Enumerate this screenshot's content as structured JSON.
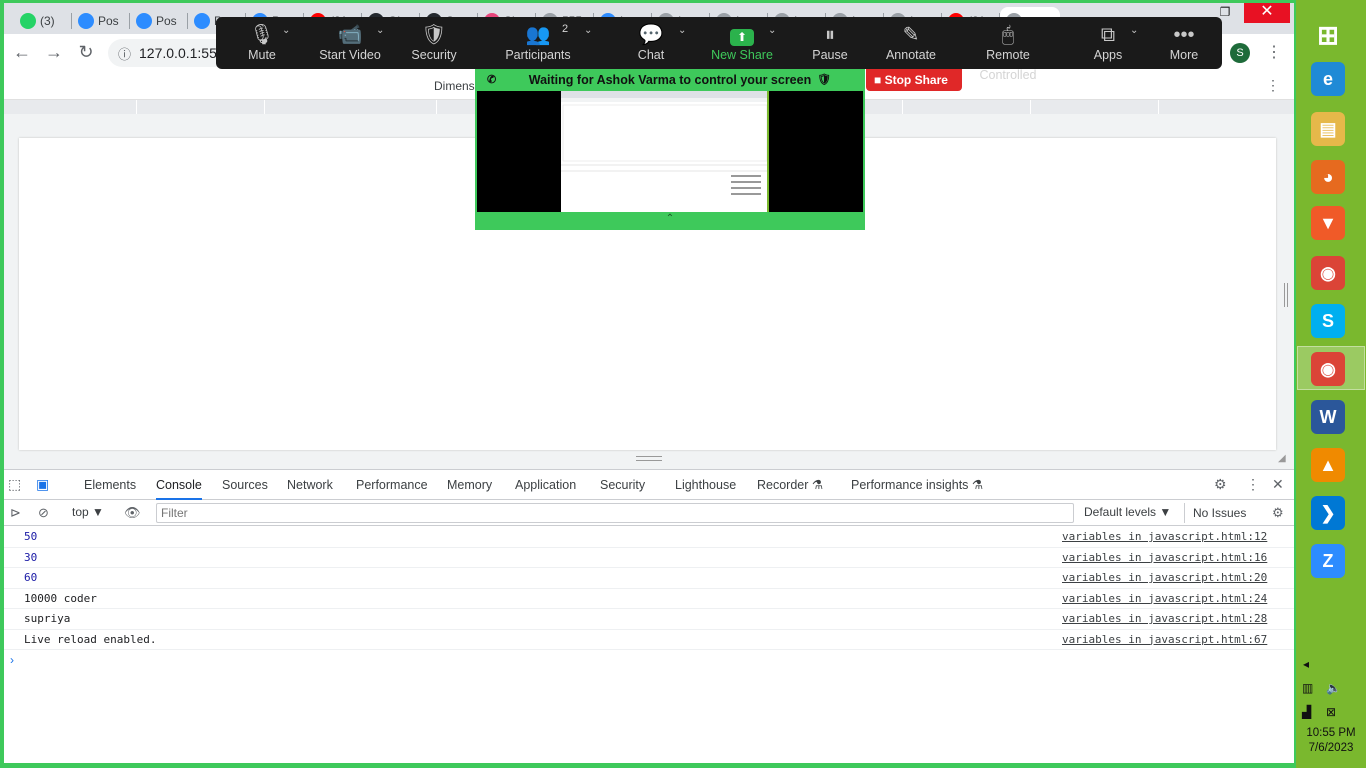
{
  "browser": {
    "tabs": [
      {
        "label": "(3)",
        "icon": "whatsapp-icon",
        "color": "#25d366"
      },
      {
        "label": "Pos",
        "icon": "zoom-icon",
        "color": "#2d8cff"
      },
      {
        "label": "Pos",
        "icon": "zoom-icon",
        "color": "#2d8cff"
      },
      {
        "label": "Pos",
        "icon": "zoom-icon",
        "color": "#2d8cff"
      },
      {
        "label": "Pos",
        "icon": "zoom-icon",
        "color": "#2d8cff"
      },
      {
        "label": "(21",
        "icon": "youtube-icon",
        "color": "#ff0000"
      },
      {
        "label": "Git",
        "icon": "github-icon",
        "color": "#24292e"
      },
      {
        "label": "Suc",
        "icon": "github-icon",
        "color": "#24292e"
      },
      {
        "label": "Sig",
        "icon": "sign-icon",
        "color": "#e8467c"
      },
      {
        "label": "555",
        "icon": "doc-icon",
        "color": "#9aa0a6"
      },
      {
        "label": "Loc",
        "icon": "zoom-icon",
        "color": "#2d8cff"
      },
      {
        "label": "Inte",
        "icon": "globe-icon",
        "color": "#9aa0a6"
      },
      {
        "label": "Inte",
        "icon": "globe-icon",
        "color": "#9aa0a6"
      },
      {
        "label": "Inte",
        "icon": "globe-icon",
        "color": "#9aa0a6"
      },
      {
        "label": "Inte",
        "icon": "globe-icon",
        "color": "#9aa0a6"
      },
      {
        "label": "Inte",
        "icon": "globe-icon",
        "color": "#9aa0a6"
      },
      {
        "label": "(21",
        "icon": "youtube-icon",
        "color": "#ff0000"
      },
      {
        "label": "",
        "icon": "globe-icon",
        "color": "#9aa0a6"
      }
    ],
    "address": "127.0.0.1:55",
    "profile_initial": "S",
    "dimensions_label": "Dimensi"
  },
  "zoom": {
    "buttons": [
      {
        "key": "mute",
        "label": "Mute",
        "glyph": "🎙"
      },
      {
        "key": "start-video",
        "label": "Start Video",
        "glyph": "📹"
      },
      {
        "key": "security",
        "label": "Security",
        "glyph": "🛡"
      },
      {
        "key": "participants",
        "label": "Participants",
        "glyph": "👥",
        "badge": "2"
      },
      {
        "key": "chat",
        "label": "Chat",
        "glyph": "💬"
      },
      {
        "key": "new-share",
        "label": "New Share",
        "glyph": "⬆"
      },
      {
        "key": "pause-share",
        "label": "Pause Share",
        "glyph": "⏸"
      },
      {
        "key": "annotate",
        "label": "Annotate",
        "glyph": "✎"
      },
      {
        "key": "remote-controlled",
        "label": "Remote Controlled",
        "glyph": "🖱"
      },
      {
        "key": "apps",
        "label": "Apps",
        "glyph": "⧉"
      },
      {
        "key": "more",
        "label": "More",
        "glyph": "•••"
      }
    ],
    "waiting_text": "Waiting for Ashok Varma to control your screen",
    "stop_share": "Stop Share"
  },
  "devtools": {
    "tabs": [
      "Elements",
      "Console",
      "Sources",
      "Network",
      "Performance",
      "Memory",
      "Application",
      "Security",
      "Lighthouse",
      "Recorder",
      "Performance insights"
    ],
    "active_tab": "Console",
    "context": "top",
    "filter_placeholder": "Filter",
    "levels": "Default levels",
    "issues": "No Issues",
    "console": [
      {
        "message": "50",
        "source": "variables in javascript.html:12",
        "numeric": true
      },
      {
        "message": "30",
        "source": "variables in javascript.html:16",
        "numeric": true
      },
      {
        "message": "60",
        "source": "variables in javascript.html:20",
        "numeric": true
      },
      {
        "message": "10000 coder",
        "source": "variables in javascript.html:24",
        "numeric": false
      },
      {
        "message": "supriya",
        "source": "variables in javascript.html:28",
        "numeric": false
      },
      {
        "message": "Live reload enabled.",
        "source": "variables in javascript.html:67",
        "numeric": false
      }
    ]
  },
  "taskbar": {
    "apps": [
      {
        "name": "windows-start-icon",
        "glyph": "⊞",
        "bg": "transparent"
      },
      {
        "name": "internet-explorer-icon",
        "glyph": "e",
        "bg": "#1f8ad6"
      },
      {
        "name": "file-explorer-icon",
        "glyph": "▤",
        "bg": "#e6b84a"
      },
      {
        "name": "firefox-icon",
        "glyph": "◕",
        "bg": "#e66a1f"
      },
      {
        "name": "brave-icon",
        "glyph": "▼",
        "bg": "#f05a28"
      },
      {
        "name": "chrome-icon",
        "glyph": "◉",
        "bg": "#db4437"
      },
      {
        "name": "skype-icon",
        "glyph": "S",
        "bg": "#00aff0"
      },
      {
        "name": "chrome-profile-icon",
        "glyph": "◉",
        "bg": "#db4437"
      },
      {
        "name": "word-icon",
        "glyph": "W",
        "bg": "#2b579a"
      },
      {
        "name": "vlc-icon",
        "glyph": "▲",
        "bg": "#f08a00"
      },
      {
        "name": "vscode-icon",
        "glyph": "❯",
        "bg": "#0078d4"
      },
      {
        "name": "zoom-icon",
        "glyph": "Z",
        "bg": "#2d8cff"
      }
    ],
    "time": "10:55 PM",
    "date": "7/6/2023"
  }
}
